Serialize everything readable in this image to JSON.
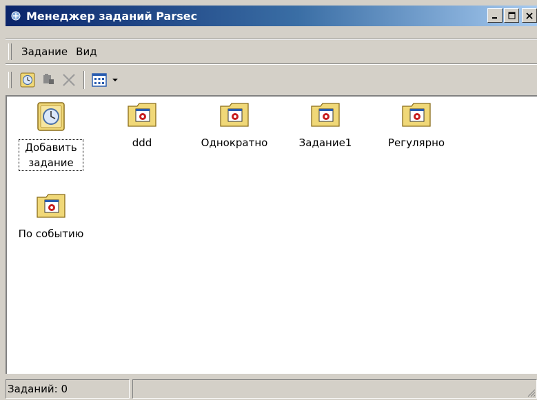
{
  "window": {
    "title": "Менеджер заданий Parsec"
  },
  "menu": {
    "items": [
      "Задание",
      "Вид"
    ]
  },
  "toolbar": {
    "icons": [
      "add-task-icon",
      "properties-icon",
      "delete-icon",
      "view-mode-icon",
      "dropdown-arrow-icon"
    ]
  },
  "content": {
    "items": [
      {
        "label": "Добавить задание",
        "icon": "add-task-icon"
      },
      {
        "label": "ddd",
        "icon": "task-folder-icon"
      },
      {
        "label": "Однократно",
        "icon": "task-folder-icon"
      },
      {
        "label": "Задание1",
        "icon": "task-folder-icon"
      },
      {
        "label": "Регулярно",
        "icon": "task-folder-icon"
      },
      {
        "label": "По событию",
        "icon": "task-folder-icon"
      }
    ]
  },
  "status": {
    "text": "Заданий: 0"
  },
  "colors": {
    "titlebar_start": "#0a246a",
    "titlebar_end": "#a6caf0",
    "face": "#d4d0c8",
    "folder": "#f0d878"
  }
}
